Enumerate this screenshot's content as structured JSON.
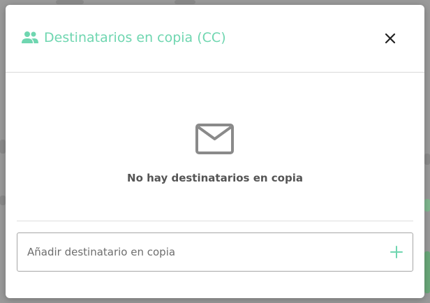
{
  "dialog": {
    "title": "Destinatarios en copia (CC)",
    "title_icon": "people-icon",
    "close_icon": "close-icon",
    "accent_color": "#6fd6b0"
  },
  "empty_state": {
    "icon": "mail-icon",
    "message": "No hay destinatarios en copia"
  },
  "add_recipient": {
    "placeholder": "Añadir destinatario en copia",
    "value": "",
    "add_icon": "plus-icon"
  }
}
